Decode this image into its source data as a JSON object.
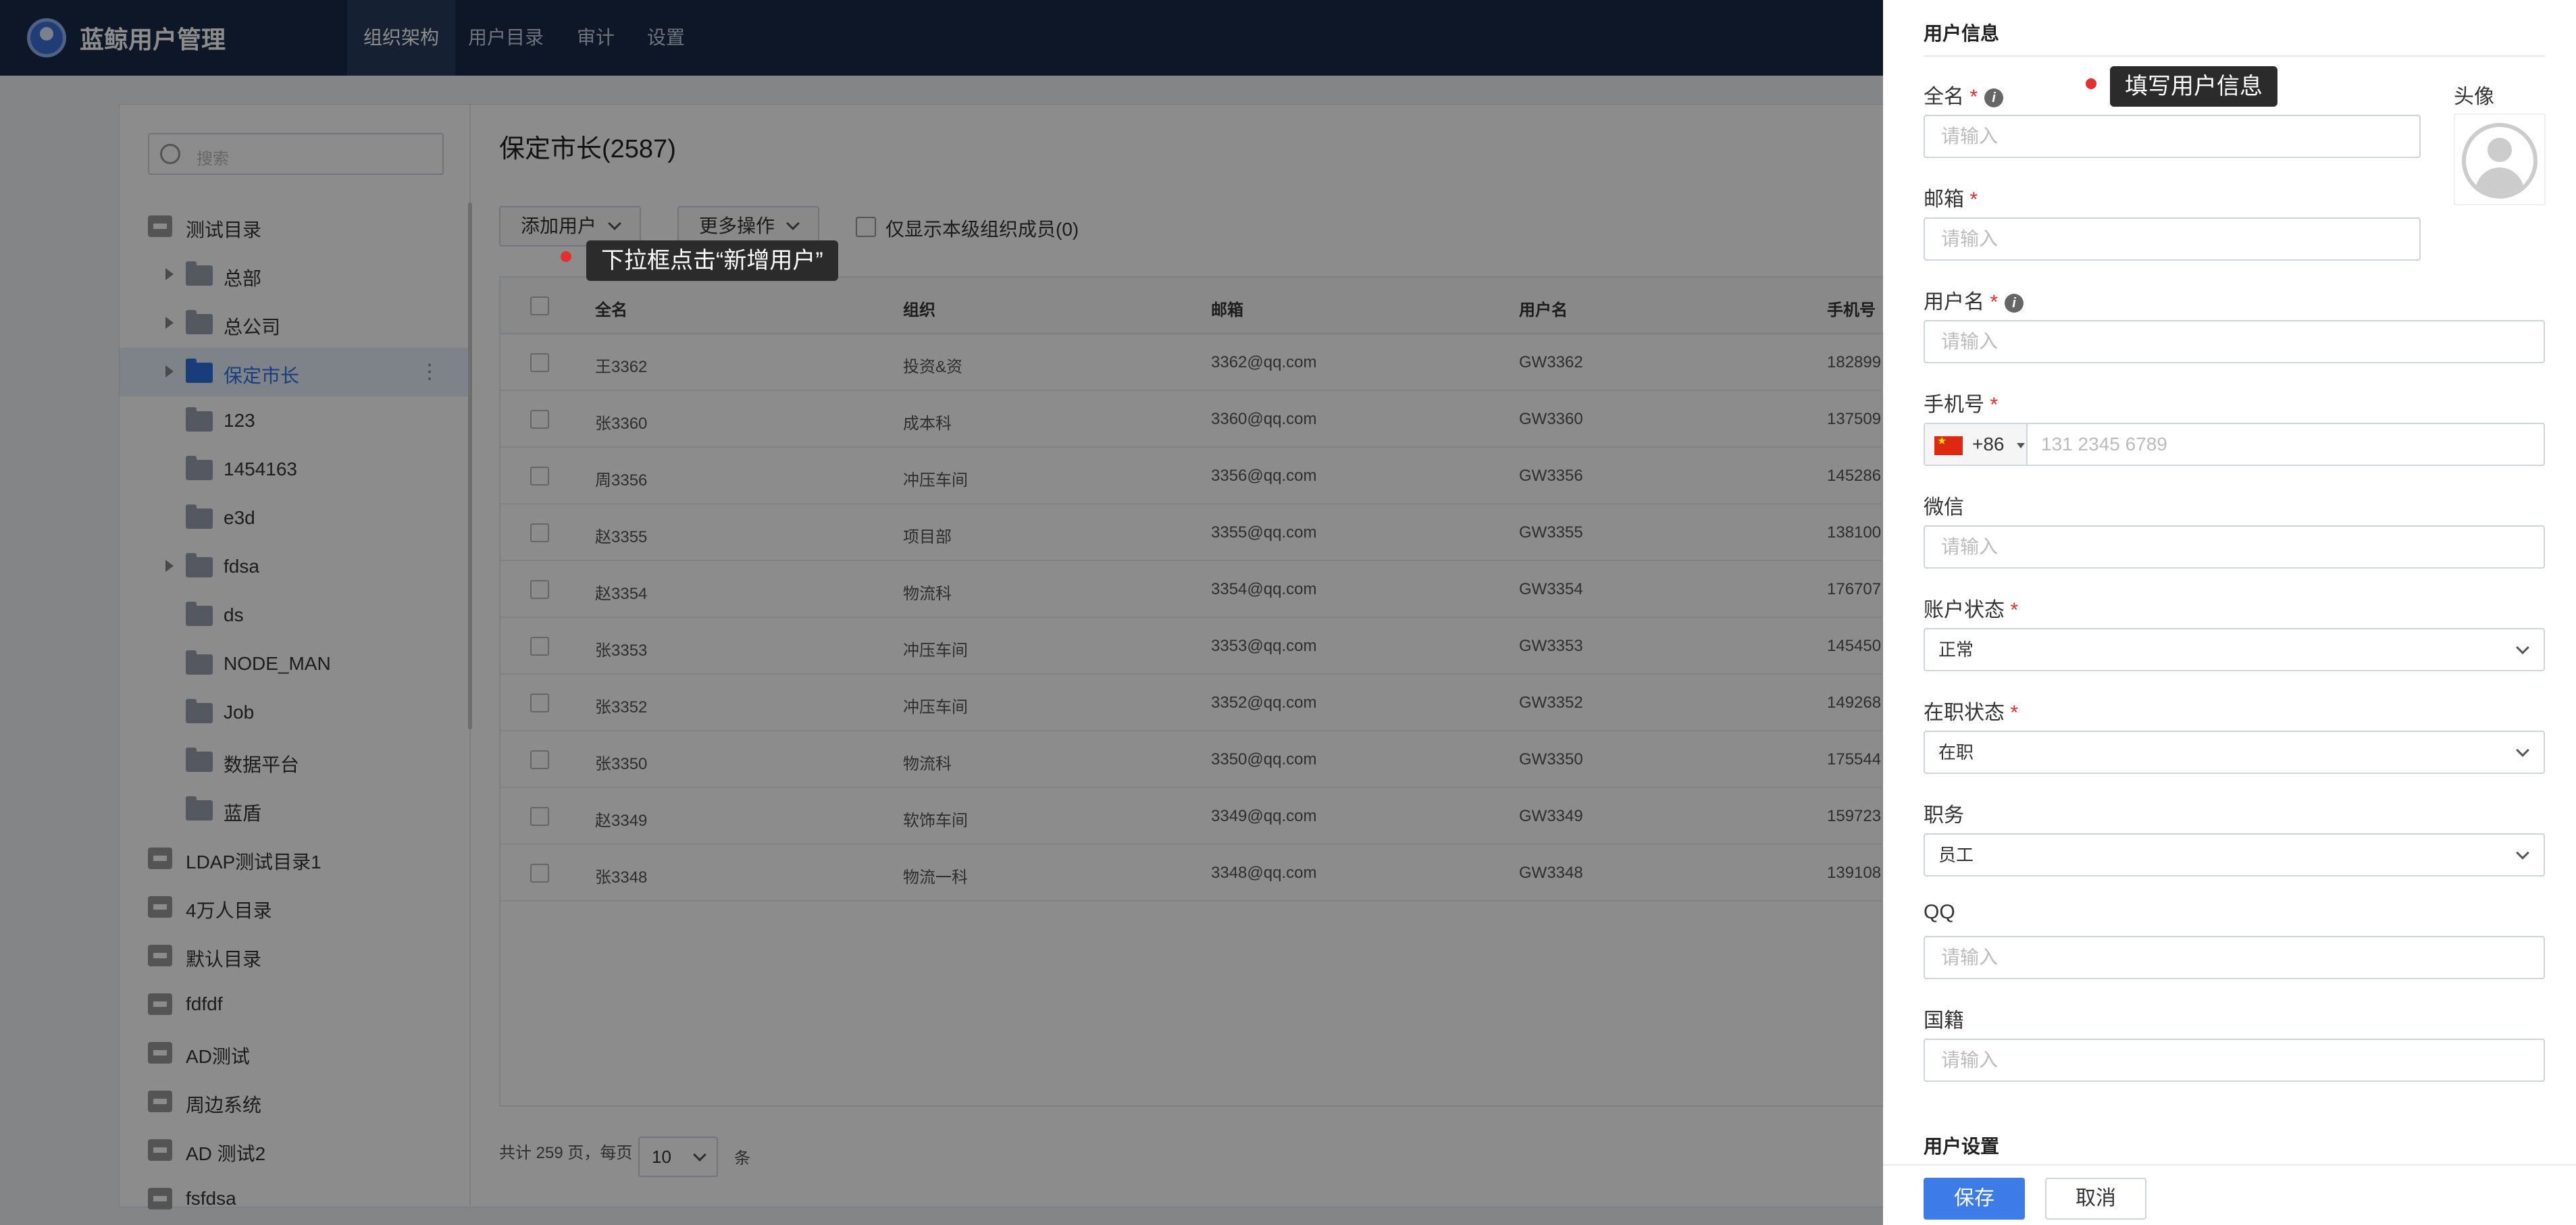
{
  "app": {
    "title": "蓝鲸用户管理"
  },
  "nav": {
    "items": [
      "组织架构",
      "用户目录",
      "审计",
      "设置"
    ]
  },
  "sidebar": {
    "search_placeholder": "搜索",
    "tree": [
      {
        "label": "测试目录",
        "type": "directory"
      },
      {
        "label": "总部",
        "type": "folder",
        "expandable": true
      },
      {
        "label": "总公司",
        "type": "folder",
        "expandable": true
      },
      {
        "label": "保定市长",
        "type": "folder",
        "expandable": true,
        "selected": true
      },
      {
        "label": "123",
        "type": "folder"
      },
      {
        "label": "1454163",
        "type": "folder"
      },
      {
        "label": "e3d",
        "type": "folder"
      },
      {
        "label": "fdsa",
        "type": "folder",
        "expandable": true
      },
      {
        "label": "ds",
        "type": "folder"
      },
      {
        "label": "NODE_MAN",
        "type": "folder"
      },
      {
        "label": "Job",
        "type": "folder"
      },
      {
        "label": "数据平台",
        "type": "folder"
      },
      {
        "label": "蓝盾",
        "type": "folder"
      },
      {
        "label": "LDAP测试目录1",
        "type": "directory"
      },
      {
        "label": "4万人目录",
        "type": "directory"
      },
      {
        "label": "默认目录",
        "type": "directory"
      },
      {
        "label": "fdfdf",
        "type": "directory"
      },
      {
        "label": "AD测试",
        "type": "directory"
      },
      {
        "label": "周边系统",
        "type": "directory"
      },
      {
        "label": "AD 测试2",
        "type": "directory"
      },
      {
        "label": "fsfdsa",
        "type": "directory"
      }
    ]
  },
  "main": {
    "title": "保定市长(2587)",
    "add_user": "添加用户",
    "more_actions": "更多操作",
    "only_current_label": "仅显示本级组织成员(0)",
    "columns": [
      "全名",
      "组织",
      "邮箱",
      "用户名",
      "手机号"
    ],
    "rows": [
      [
        "王3362",
        "投资&资",
        "3362@qq.com",
        "GW3362",
        "182899"
      ],
      [
        "张3360",
        "成本科",
        "3360@qq.com",
        "GW3360",
        "137509"
      ],
      [
        "周3356",
        "冲压车间",
        "3356@qq.com",
        "GW3356",
        "145286"
      ],
      [
        "赵3355",
        "项目部",
        "3355@qq.com",
        "GW3355",
        "138100"
      ],
      [
        "赵3354",
        "物流科",
        "3354@qq.com",
        "GW3354",
        "176707"
      ],
      [
        "张3353",
        "冲压车间",
        "3353@qq.com",
        "GW3353",
        "145450"
      ],
      [
        "张3352",
        "冲压车间",
        "3352@qq.com",
        "GW3352",
        "149268"
      ],
      [
        "张3350",
        "物流科",
        "3350@qq.com",
        "GW3350",
        "175544"
      ],
      [
        "赵3349",
        "软饰车间",
        "3349@qq.com",
        "GW3349",
        "159723"
      ],
      [
        "张3348",
        "物流一科",
        "3348@qq.com",
        "GW3348",
        "139108"
      ]
    ],
    "pager": {
      "summary": "共计 259 页，每页",
      "page_size": "10",
      "unit": "条"
    }
  },
  "tooltips": {
    "add_user_tip": "下拉框点击“新增用户”",
    "fill_info_tip": "填写用户信息"
  },
  "drawer": {
    "section_user_info": "用户信息",
    "avatar_label": "头像",
    "fields": {
      "full_name": {
        "label": "全名",
        "placeholder": "请输入"
      },
      "email": {
        "label": "邮箱",
        "placeholder": "请输入"
      },
      "username": {
        "label": "用户名",
        "placeholder": "请输入"
      },
      "phone": {
        "label": "手机号",
        "country_code": "+86",
        "placeholder": "131 2345 6789"
      },
      "wechat": {
        "label": "微信",
        "placeholder": "请输入"
      },
      "account_status": {
        "label": "账户状态",
        "value": "正常"
      },
      "employment_status": {
        "label": "在职状态",
        "value": "在职"
      },
      "position": {
        "label": "职务",
        "value": "员工"
      },
      "qq": {
        "label": "QQ",
        "placeholder": "请输入"
      },
      "nationality": {
        "label": "国籍",
        "placeholder": "请输入"
      }
    },
    "required_mark": "*",
    "info_icon": "i",
    "section_user_settings": "用户设置",
    "save": "保存",
    "cancel": "取消"
  },
  "colors": {
    "nav_bg": "#1a2a4a",
    "accent": "#3d7be6",
    "required": "#e52e2e",
    "hint_dot": "#e52e2e"
  }
}
